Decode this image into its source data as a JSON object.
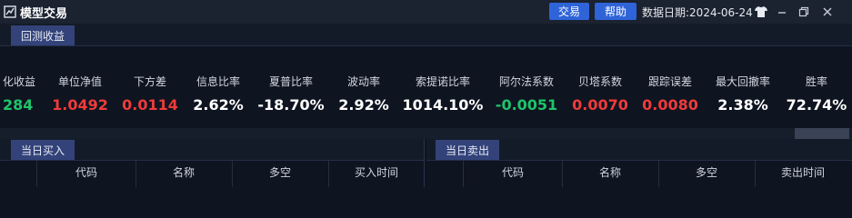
{
  "titlebar": {
    "title": "模型交易",
    "trade_button": "交易",
    "help_button": "帮助",
    "date_label": "数据日期:2024-06-24"
  },
  "backtest": {
    "tab_label": "回测收益",
    "metrics": [
      {
        "label": "化收益",
        "value": "284",
        "color": "green"
      },
      {
        "label": "单位净值",
        "value": "1.0492",
        "color": "red"
      },
      {
        "label": "下方差",
        "value": "0.0114",
        "color": "red"
      },
      {
        "label": "信息比率",
        "value": "2.62%",
        "color": "white"
      },
      {
        "label": "夏普比率",
        "value": "-18.70%",
        "color": "white"
      },
      {
        "label": "波动率",
        "value": "2.92%",
        "color": "white"
      },
      {
        "label": "索提诺比率",
        "value": "1014.10%",
        "color": "white"
      },
      {
        "label": "阿尔法系数",
        "value": "-0.0051",
        "color": "green"
      },
      {
        "label": "贝塔系数",
        "value": "0.0070",
        "color": "red"
      },
      {
        "label": "跟踪误差",
        "value": "0.0080",
        "color": "red"
      },
      {
        "label": "最大回撤率",
        "value": "2.38%",
        "color": "white"
      },
      {
        "label": "胜率",
        "value": "72.74%",
        "color": "white"
      }
    ]
  },
  "buy_panel": {
    "tab_label": "当日买入",
    "columns": [
      "代码",
      "名称",
      "多空",
      "买入时间"
    ]
  },
  "sell_panel": {
    "tab_label": "当日卖出",
    "columns": [
      "代码",
      "名称",
      "多空",
      "卖出时间"
    ]
  },
  "colors": {
    "red": "#ef3b3b",
    "green": "#1fc46a",
    "accent": "#2f63d8"
  },
  "icons": [
    "app-icon",
    "theme-shirt-icon",
    "minimize-icon",
    "restore-icon",
    "close-icon"
  ]
}
